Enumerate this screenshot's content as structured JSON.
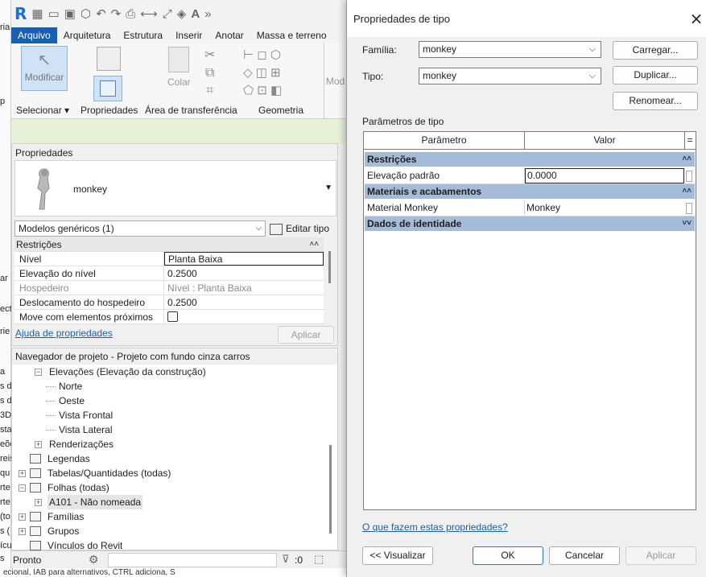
{
  "app": {
    "quick_access": [
      "R"
    ],
    "ribbon_tabs": [
      "Arquivo",
      "Arquitetura",
      "Estrutura",
      "Inserir",
      "Anotar",
      "Massa e terreno"
    ],
    "active_tab": "Arquivo",
    "ribbon_buttons": {
      "modificar": "Modificar",
      "selecionar": "Selecionar",
      "propriedades": "Propriedades",
      "colar": "Colar",
      "area_transferencia": "Área de transferência",
      "geometria": "Geometria",
      "mod_partial": "Mod"
    },
    "left_strip_fragments": [
      "ria",
      "p",
      "ar",
      "ect",
      "rie",
      "a",
      "s d",
      "s d",
      "3D",
      "sta",
      "eõe",
      "reis",
      "qu",
      "rte",
      "rte",
      "(to",
      "s (",
      "ícu",
      "s"
    ]
  },
  "properties_panel": {
    "title": "Propriedades",
    "family_name": "monkey",
    "category_selector": "Modelos genéricos (1)",
    "edit_type_label": "Editar tipo",
    "section": "Restrições",
    "rows": [
      {
        "name": "Nível",
        "value": "Planta Baixa",
        "grayed": false
      },
      {
        "name": "Elevação do nível",
        "value": "0.2500",
        "grayed": false
      },
      {
        "name": "Hospedeiro",
        "value": "Nível : Planta Baixa",
        "grayed": true
      },
      {
        "name": "Deslocamento do hospedeiro",
        "value": "0.2500",
        "grayed": false
      },
      {
        "name": "Move com elementos próximos",
        "value": "",
        "grayed": false
      }
    ],
    "help_link": "Ajuda de propriedades",
    "apply_label": "Aplicar"
  },
  "project_browser": {
    "title": "Navegador de projeto - Projeto com fundo cinza carros",
    "items": [
      {
        "label": "Elevações (Elevação da construção)",
        "level": 1,
        "toggle": "−"
      },
      {
        "label": "Norte",
        "level": 2,
        "toggle": ""
      },
      {
        "label": "Oeste",
        "level": 2,
        "toggle": ""
      },
      {
        "label": "Vista Frontal",
        "level": 2,
        "toggle": ""
      },
      {
        "label": "Vista Lateral",
        "level": 2,
        "toggle": ""
      },
      {
        "label": "Renderizações",
        "level": 1,
        "toggle": "+"
      },
      {
        "label": "Legendas",
        "level": 0,
        "toggle": "",
        "icon": true
      },
      {
        "label": "Tabelas/Quantidades (todas)",
        "level": 0,
        "toggle": "+",
        "icon": true
      },
      {
        "label": "Folhas (todas)",
        "level": 0,
        "toggle": "−",
        "icon": true
      },
      {
        "label": "A101 - Não nomeada",
        "level": 1,
        "toggle": "+",
        "selected": true
      },
      {
        "label": "Famílias",
        "level": 0,
        "toggle": "+",
        "icon": true
      },
      {
        "label": "Grupos",
        "level": 0,
        "toggle": "+",
        "icon": true
      },
      {
        "label": "Vínculos do Revit",
        "level": 0,
        "toggle": "",
        "icon": true
      }
    ]
  },
  "status_bar": {
    "text": "Pronto",
    "counter": ":0",
    "bottom_text": "ecional, IAB para alternativos, CTRL adiciona, S"
  },
  "dialog": {
    "title": "Propriedades de tipo",
    "family_label": "Família:",
    "family_value": "monkey",
    "type_label": "Tipo:",
    "type_value": "monkey",
    "load_button": "Carregar...",
    "duplicate_button": "Duplicar...",
    "rename_button": "Renomear...",
    "type_params_label": "Parâmetros de tipo",
    "col_param": "Parâmetro",
    "col_value": "Valor",
    "col_eq": "=",
    "sections": [
      {
        "title": "Restrições",
        "chevron": "˄˄",
        "rows": [
          {
            "name": "Elevação padrão",
            "value": "0.0000"
          }
        ]
      },
      {
        "title": "Materiais e acabamentos",
        "chevron": "˄˄",
        "rows": [
          {
            "name": "Material Monkey",
            "value": "Monkey"
          }
        ]
      },
      {
        "title": "Dados de identidade",
        "chevron": "˅˅",
        "rows": []
      }
    ],
    "help_link": "O que fazem estas propriedades?",
    "preview_button": "<< Visualizar",
    "ok_button": "OK",
    "cancel_button": "Cancelar",
    "apply_button": "Aplicar"
  },
  "colors": {
    "accent": "#1a5faf",
    "section_header": "#a5bcd8",
    "ribbon_green": "#e6f1d8"
  }
}
